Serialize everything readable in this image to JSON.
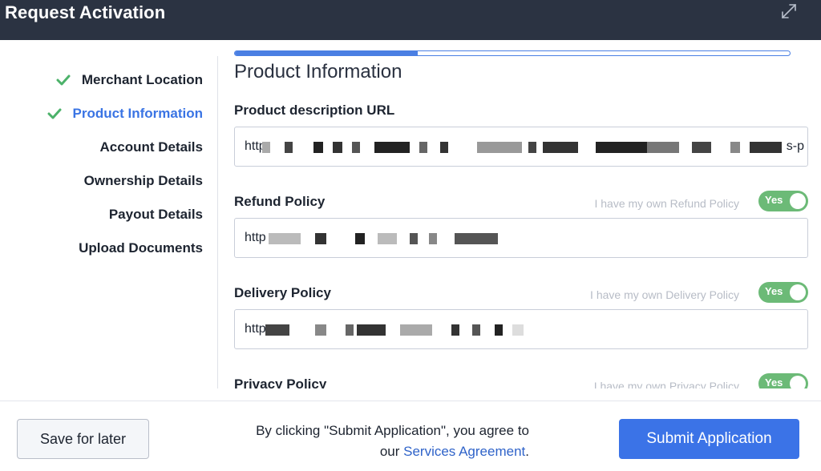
{
  "window": {
    "title": "Request Activation",
    "expand_icon": "expand-arrows-icon"
  },
  "sidebar": {
    "items": [
      {
        "label": "Merchant Location",
        "completed": true,
        "active": false
      },
      {
        "label": "Product Information",
        "completed": true,
        "active": true
      },
      {
        "label": "Account Details",
        "completed": false,
        "active": false
      },
      {
        "label": "Ownership Details",
        "completed": false,
        "active": false
      },
      {
        "label": "Payout Details",
        "completed": false,
        "active": false
      },
      {
        "label": "Upload Documents",
        "completed": false,
        "active": false
      }
    ],
    "check_color": "#4cb26a",
    "active_color": "#3a74e4"
  },
  "main": {
    "progress_fraction": 0.33,
    "section_title": "Product Information",
    "fields": {
      "product_url": {
        "label": "Product description URL",
        "value": "http",
        "value_suffix": "s-p"
      },
      "refund": {
        "label": "Refund Policy",
        "toggle_label": "I have my own Refund Policy",
        "toggle_value": "Yes",
        "value": "http"
      },
      "delivery": {
        "label": "Delivery Policy",
        "toggle_label": "I have my own Delivery Policy",
        "toggle_value": "Yes",
        "value": "http"
      },
      "privacy": {
        "label": "Privacy Policy",
        "toggle_label": "I have my own Privacy Policy",
        "toggle_value": "Yes"
      }
    }
  },
  "footer": {
    "save_label": "Save for later",
    "agree_text": "By clicking \"Submit Application\", you agree to",
    "agree_prefix": "our",
    "agree_link": "Services Agreement",
    "agree_suffix": ".",
    "submit_label": "Submit Application"
  },
  "colors": {
    "titlebar": "#2b3342",
    "accent": "#3b73e7",
    "toggle_on": "#6cba77"
  }
}
